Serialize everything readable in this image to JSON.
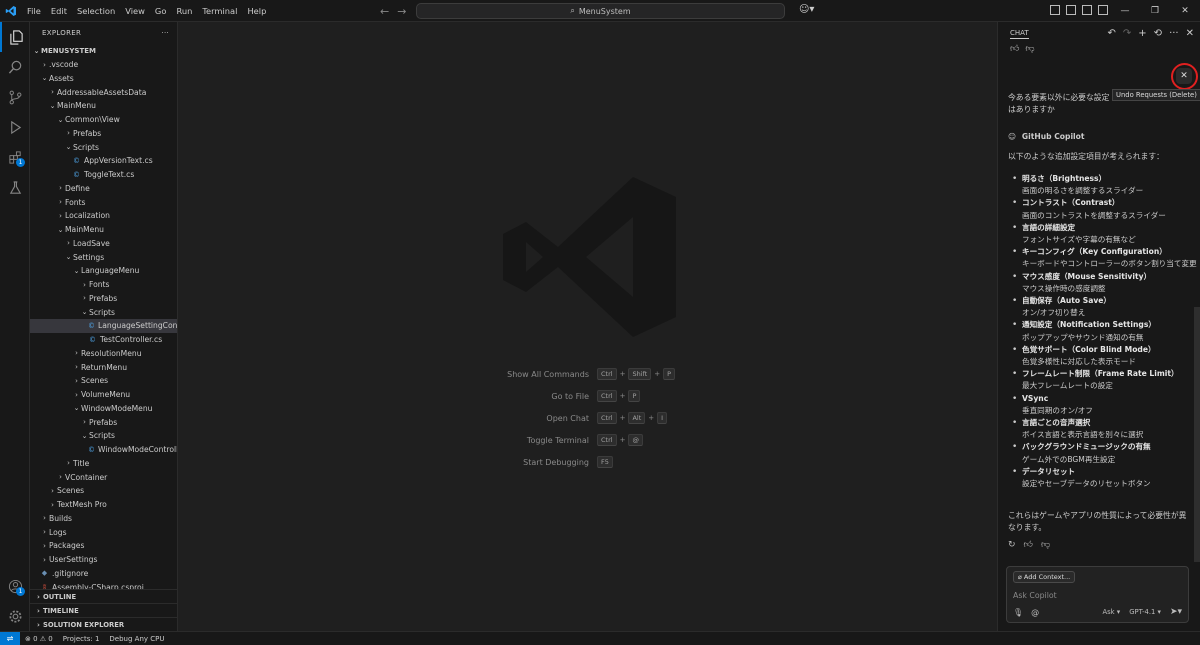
{
  "menu": [
    "File",
    "Edit",
    "Selection",
    "View",
    "Go",
    "Run",
    "Terminal",
    "Help"
  ],
  "command_center": "MenuSystem",
  "explorer": {
    "header": "EXPLORER",
    "rows": [
      {
        "label": "MENUSYSTEM",
        "depth": 0,
        "type": "folder",
        "open": true,
        "bold": true
      },
      {
        "label": ".vscode",
        "depth": 1,
        "type": "folder",
        "open": false
      },
      {
        "label": "Assets",
        "depth": 1,
        "type": "folder",
        "open": true
      },
      {
        "label": "AddressableAssetsData",
        "depth": 2,
        "type": "folder",
        "open": false
      },
      {
        "label": "MainMenu",
        "depth": 2,
        "type": "folder",
        "open": true
      },
      {
        "label": "Common\\View",
        "depth": 3,
        "type": "folder",
        "open": true
      },
      {
        "label": "Prefabs",
        "depth": 4,
        "type": "folder",
        "open": false
      },
      {
        "label": "Scripts",
        "depth": 4,
        "type": "folder",
        "open": true
      },
      {
        "label": "AppVersionText.cs",
        "depth": 5,
        "type": "cs"
      },
      {
        "label": "ToggleText.cs",
        "depth": 5,
        "type": "cs"
      },
      {
        "label": "Define",
        "depth": 3,
        "type": "folder",
        "open": false
      },
      {
        "label": "Fonts",
        "depth": 3,
        "type": "folder",
        "open": false
      },
      {
        "label": "Localization",
        "depth": 3,
        "type": "folder",
        "open": false
      },
      {
        "label": "MainMenu",
        "depth": 3,
        "type": "folder",
        "open": true
      },
      {
        "label": "LoadSave",
        "depth": 4,
        "type": "folder",
        "open": false
      },
      {
        "label": "Settings",
        "depth": 4,
        "type": "folder",
        "open": true
      },
      {
        "label": "LanguageMenu",
        "depth": 5,
        "type": "folder",
        "open": true
      },
      {
        "label": "Fonts",
        "depth": 6,
        "type": "folder",
        "open": false
      },
      {
        "label": "Prefabs",
        "depth": 6,
        "type": "folder",
        "open": false
      },
      {
        "label": "Scripts",
        "depth": 6,
        "type": "folder",
        "open": true
      },
      {
        "label": "LanguageSettingControll...",
        "depth": 7,
        "type": "cs",
        "selected": true
      },
      {
        "label": "TestController.cs",
        "depth": 7,
        "type": "cs"
      },
      {
        "label": "ResolutionMenu",
        "depth": 5,
        "type": "folder",
        "open": false
      },
      {
        "label": "ReturnMenu",
        "depth": 5,
        "type": "folder",
        "open": false
      },
      {
        "label": "Scenes",
        "depth": 5,
        "type": "folder",
        "open": false
      },
      {
        "label": "VolumeMenu",
        "depth": 5,
        "type": "folder",
        "open": false
      },
      {
        "label": "WindowModeMenu",
        "depth": 5,
        "type": "folder",
        "open": true
      },
      {
        "label": "Prefabs",
        "depth": 6,
        "type": "folder",
        "open": false
      },
      {
        "label": "Scripts",
        "depth": 6,
        "type": "folder",
        "open": true
      },
      {
        "label": "WindowModeController.cs",
        "depth": 7,
        "type": "cs"
      },
      {
        "label": "Title",
        "depth": 4,
        "type": "folder",
        "open": false
      },
      {
        "label": "VContainer",
        "depth": 3,
        "type": "folder",
        "open": false
      },
      {
        "label": "Scenes",
        "depth": 2,
        "type": "folder",
        "open": false
      },
      {
        "label": "TextMesh Pro",
        "depth": 2,
        "type": "folder",
        "open": false
      },
      {
        "label": "Builds",
        "depth": 1,
        "type": "folder",
        "open": false
      },
      {
        "label": "Logs",
        "depth": 1,
        "type": "folder",
        "open": false
      },
      {
        "label": "Packages",
        "depth": 1,
        "type": "folder",
        "open": false
      },
      {
        "label": "UserSettings",
        "depth": 1,
        "type": "folder",
        "open": false
      },
      {
        "label": ".gitignore",
        "depth": 1,
        "type": "git"
      },
      {
        "label": "Assembly-CSharp.csproj",
        "depth": 1,
        "type": "proj"
      }
    ],
    "sections": [
      "OUTLINE",
      "TIMELINE",
      "SOLUTION EXPLORER"
    ]
  },
  "editor": {
    "shortcuts": [
      {
        "label": "Show All Commands",
        "keys": [
          "Ctrl",
          "Shift",
          "P"
        ]
      },
      {
        "label": "Go to File",
        "keys": [
          "Ctrl",
          "P"
        ]
      },
      {
        "label": "Open Chat",
        "keys": [
          "Ctrl",
          "Alt",
          "I"
        ]
      },
      {
        "label": "Toggle Terminal",
        "keys": [
          "Ctrl",
          "@"
        ]
      },
      {
        "label": "Start Debugging",
        "keys": [
          "F5"
        ]
      }
    ]
  },
  "chat": {
    "title": "CHAT",
    "tooltip": "Undo Requests (Delete)",
    "user_message": "今ある要素以外に必要な設定はありますか",
    "assistant_name": "GitHub Copilot",
    "intro": "以下のような追加設定項目が考えられます：",
    "items": [
      {
        "title": "明るさ（Brightness）",
        "desc": "画面の明るさを調整するスライダー"
      },
      {
        "title": "コントラスト（Contrast）",
        "desc": "画面のコントラストを調整するスライダー"
      },
      {
        "title": "言語の詳細設定",
        "desc": "フォントサイズや字幕の有無など"
      },
      {
        "title": "キーコンフィグ（Key Configuration）",
        "desc": "キーボードやコントローラーのボタン割り当て変更"
      },
      {
        "title": "マウス感度（Mouse Sensitivity）",
        "desc": "マウス操作時の感度調整"
      },
      {
        "title": "自動保存（Auto Save）",
        "desc": "オン/オフ切り替え"
      },
      {
        "title": "通知設定（Notification Settings）",
        "desc": "ポップアップやサウンド通知の有無"
      },
      {
        "title": "色覚サポート（Color Blind Mode）",
        "desc": "色覚多様性に対応した表示モード"
      },
      {
        "title": "フレームレート制限（Frame Rate Limit）",
        "desc": "最大フレームレートの設定"
      },
      {
        "title": "VSync",
        "desc": "垂直同期のオン/オフ"
      },
      {
        "title": "言語ごとの音声選択",
        "desc": "ボイス言語と表示言語を別々に選択"
      },
      {
        "title": "バックグラウンドミュージックの有無",
        "desc": "ゲーム外でのBGM再生設定"
      },
      {
        "title": "データリセット",
        "desc": "設定やセーブデータのリセットボタン"
      }
    ],
    "closing": "これらはゲームやアプリの性質によって必要性が異なります。",
    "add_context": "Add Context...",
    "input_placeholder": "Ask Copilot",
    "mode": "Ask",
    "model": "GPT-4.1"
  },
  "statusbar": {
    "problems": "0",
    "warnings": "0",
    "projects": "Projects: 1",
    "debug": "Debug Any CPU"
  },
  "badges": {
    "extensions": "1",
    "accounts": "1"
  }
}
